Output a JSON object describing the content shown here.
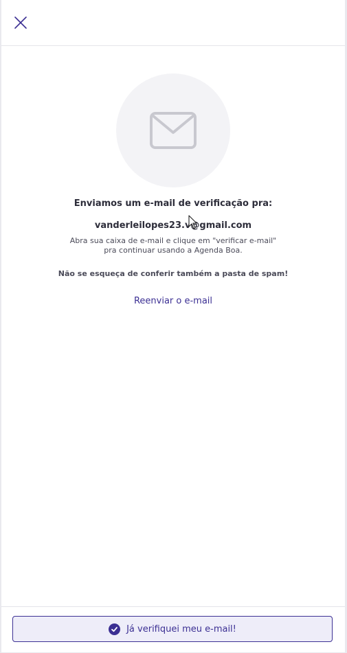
{
  "title": "Enviamos um e-mail de verificação pra:",
  "email": "vanderleilopes23.v@gmail.com",
  "instructions": {
    "line1": "Abra sua caixa de e-mail e clique em \"verificar e-mail\"",
    "line2": "pra continuar usando a Agenda Boa."
  },
  "spam_notice": "Não se esqueça de conferir também a pasta de spam!",
  "resend_link": "Reenviar o e-mail",
  "verified_button": "Já verifiquei meu e-mail!",
  "icons": {
    "close": "close-icon",
    "envelope": "envelope-icon",
    "check": "check-circle-icon"
  },
  "colors": {
    "accent": "#3b2f93",
    "button_bg": "#eeedf9",
    "circle_bg": "#f3f3f6",
    "text": "#2d2d3a"
  }
}
